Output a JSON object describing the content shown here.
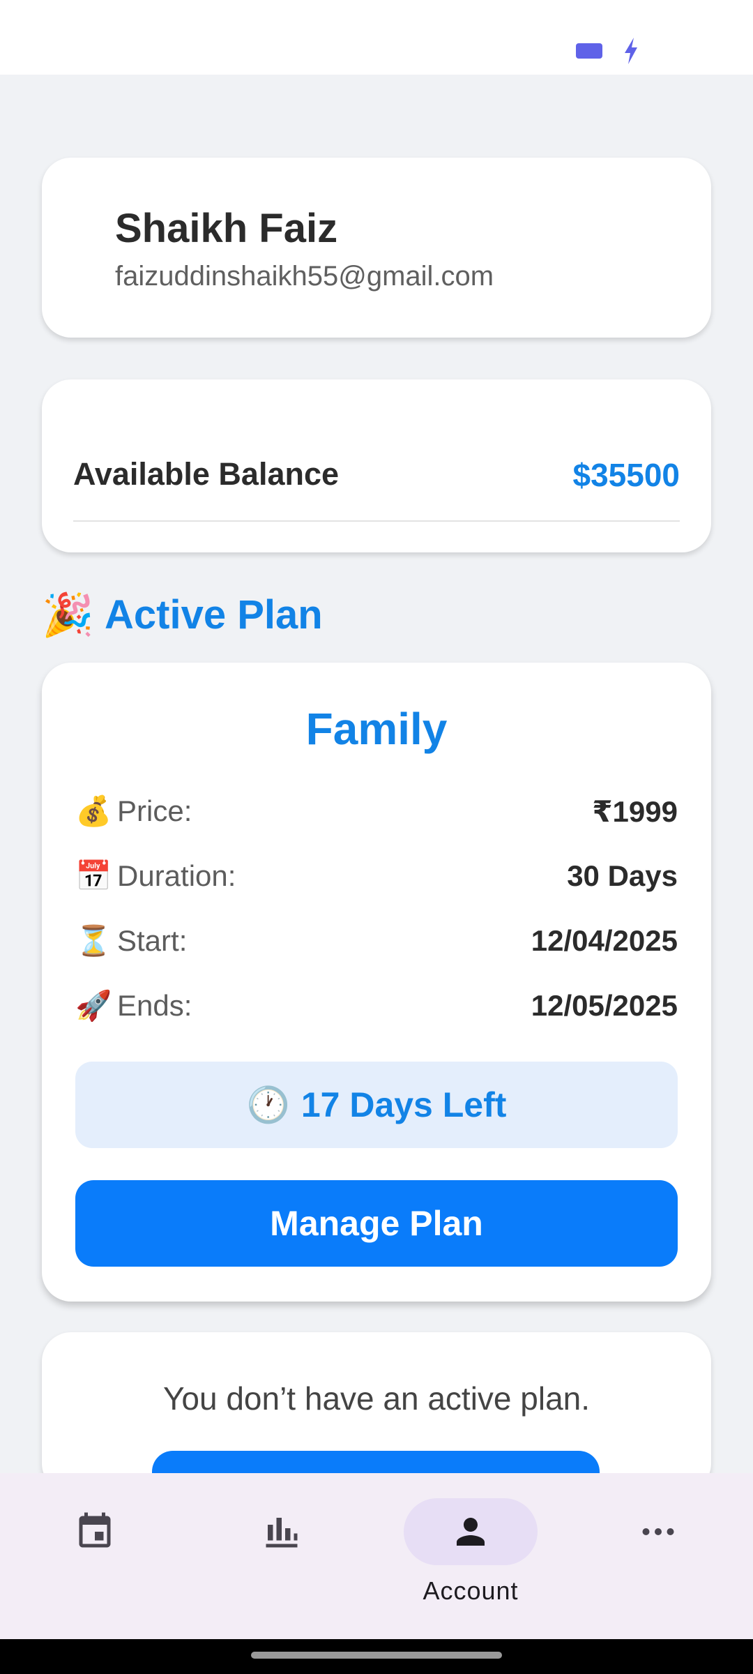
{
  "profile": {
    "name": "Shaikh Faiz",
    "email": "faizuddinshaikh55@gmail.com"
  },
  "balance": {
    "label": "Available Balance",
    "value": "$35500"
  },
  "active_plan_section": {
    "emoji": "🎉",
    "title": "Active Plan"
  },
  "plan": {
    "name": "Family",
    "rows": [
      {
        "emoji": "💰",
        "label": "Price:",
        "value": "₹1999"
      },
      {
        "emoji": "📅",
        "label": "Duration:",
        "value": "30 Days"
      },
      {
        "emoji": "⏳",
        "label": "Start:",
        "value": "12/04/2025"
      },
      {
        "emoji": "🚀",
        "label": "Ends:",
        "value": "12/05/2025"
      }
    ],
    "days_left_emoji": "🕐",
    "days_left": "17 Days Left",
    "manage_button": "Manage Plan"
  },
  "no_plan": {
    "message": "You don’t have an active plan."
  },
  "bottom_nav": {
    "items": [
      {
        "icon": "calendar-icon",
        "label": ""
      },
      {
        "icon": "bar-chart-icon",
        "label": ""
      },
      {
        "icon": "person-icon",
        "label": "Account",
        "selected": true
      },
      {
        "icon": "more-horizontal-icon",
        "label": ""
      }
    ]
  },
  "colors": {
    "accent": "#1283e6",
    "button": "#0a7cfa",
    "days_left_bg": "#e4eefc",
    "nav_bg": "#f3edf6",
    "nav_indicator": "#e7def5",
    "battery": "#5f62e8"
  }
}
